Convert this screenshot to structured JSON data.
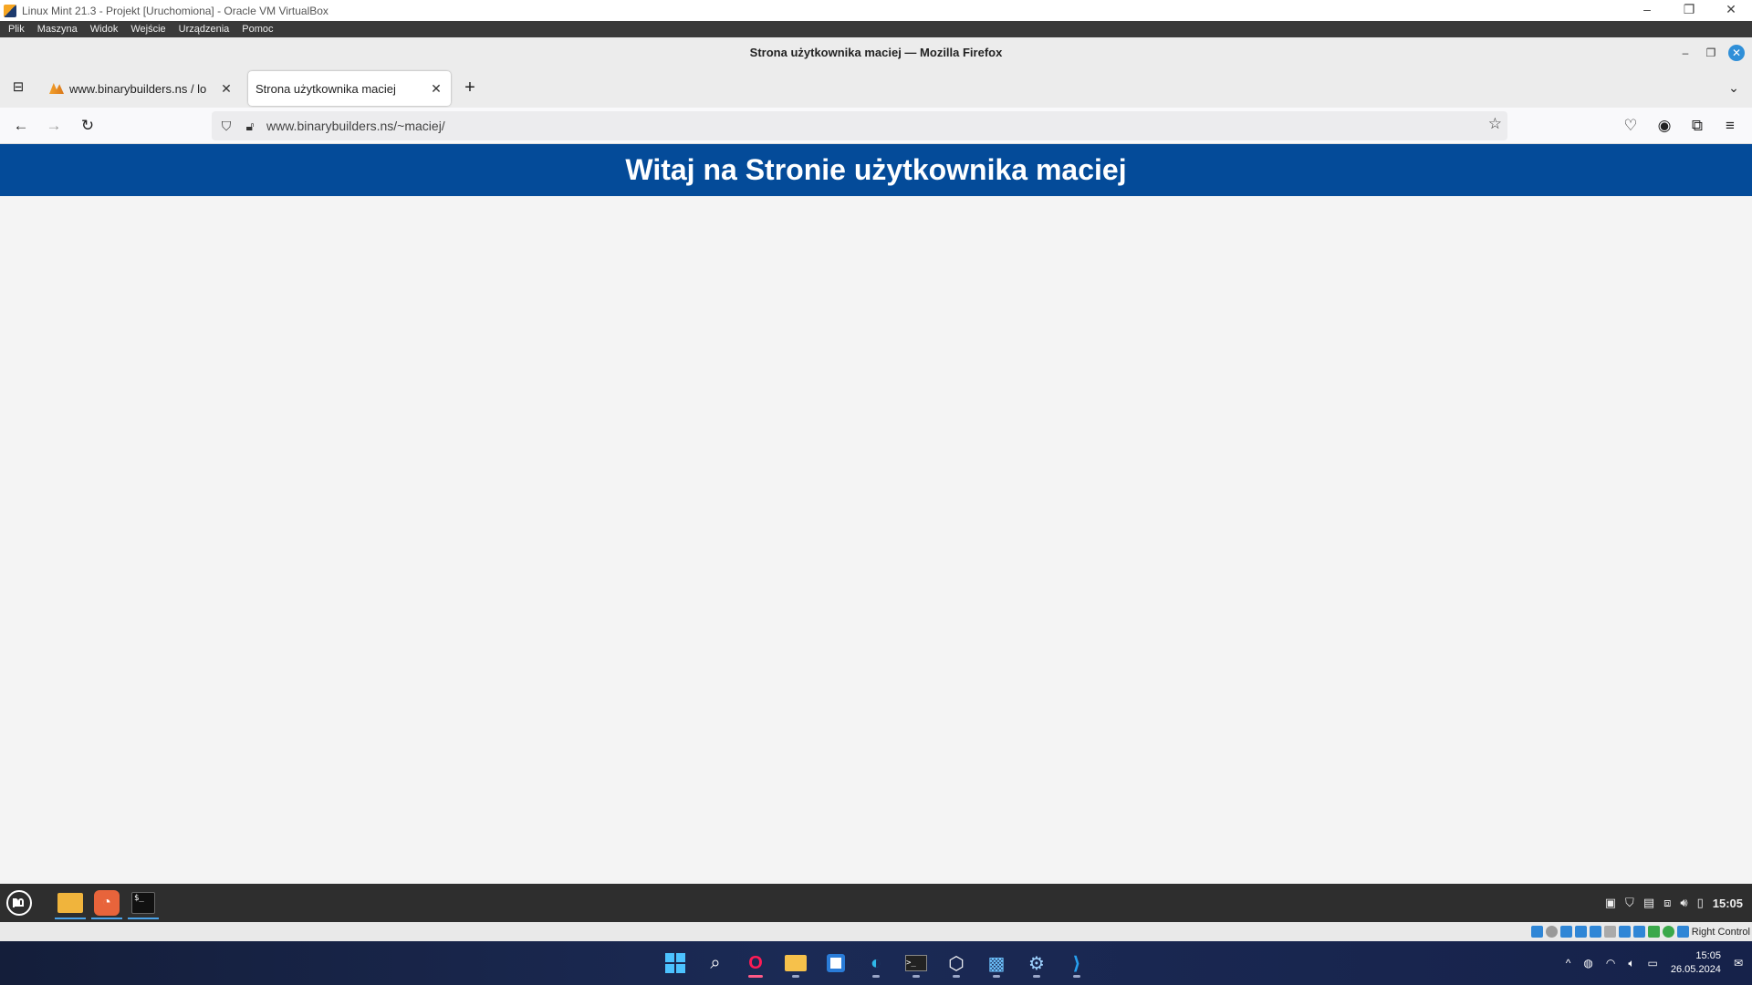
{
  "vbox": {
    "title": "Linux Mint 21.3 - Projekt [Uruchomiona] - Oracle VM VirtualBox",
    "menu": [
      "Plik",
      "Maszyna",
      "Widok",
      "Wejście",
      "Urządzenia",
      "Pomoc"
    ],
    "window_buttons": [
      "–",
      "❐",
      "✕"
    ],
    "status_right_label": "Right Control"
  },
  "firefox": {
    "window_title": "Strona użytkownika maciej — Mozilla Firefox",
    "tabs": [
      {
        "label": "www.binarybuilders.ns / lo",
        "active": false
      },
      {
        "label": "Strona użytkownika maciej",
        "active": true
      }
    ],
    "new_tab_symbol": "+",
    "url": "www.binarybuilders.ns/~maciej/"
  },
  "page": {
    "heading": "Witaj na Stronie użytkownika maciej",
    "header_color": "#044b99"
  },
  "mint_panel": {
    "clock": "15:05",
    "apps": [
      "files",
      "firefox",
      "terminal"
    ]
  },
  "windows_taskbar": {
    "time": "15:05",
    "date": "26.05.2024",
    "pinned": [
      "start",
      "search",
      "opera",
      "file-explorer",
      "store",
      "edge",
      "terminal",
      "virtualbox",
      "remote-desktop",
      "network-tool",
      "vscode"
    ]
  }
}
